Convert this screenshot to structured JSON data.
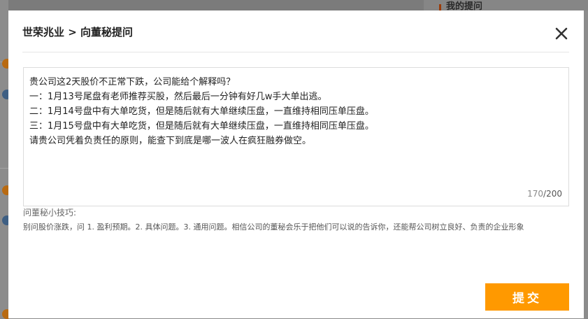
{
  "background": {
    "top_tab_label": "我的提问"
  },
  "modal": {
    "title": "世荣兆业 > 向董秘提问",
    "question_text": "贵公司这2天股价不正常下跌，公司能给个解释吗？\n一：1月13号尾盘有老师推荐买股，然后最后一分钟有好几w手大单出逃。\n二：1月14号盘中有大单吃货，但是随后就有大单继续压盘，一直维持相同压单压盘。\n三：1月15号盘中有大单吃货，但是随后就有大单继续压盘，一直维持相同压单压盘。\n请贵公司凭着负责任的原则，能查下到底是哪一波人在疯狂融券做空。",
    "char_count_used": "170",
    "char_count_max": "/200",
    "tips_title": "问董秘小技巧:",
    "tips_body": "别问股价涨跌，问 1. 盈利预期。2. 具体问题。3. 通用问题。相信公司的董秘会乐于把他们可以说的告诉你，还能帮公司树立良好、负责的企业形象",
    "submit_label": "提交",
    "close_icon": "close-icon"
  },
  "colors": {
    "accent": "#ff9900",
    "overlay": "#7b7b7b"
  }
}
